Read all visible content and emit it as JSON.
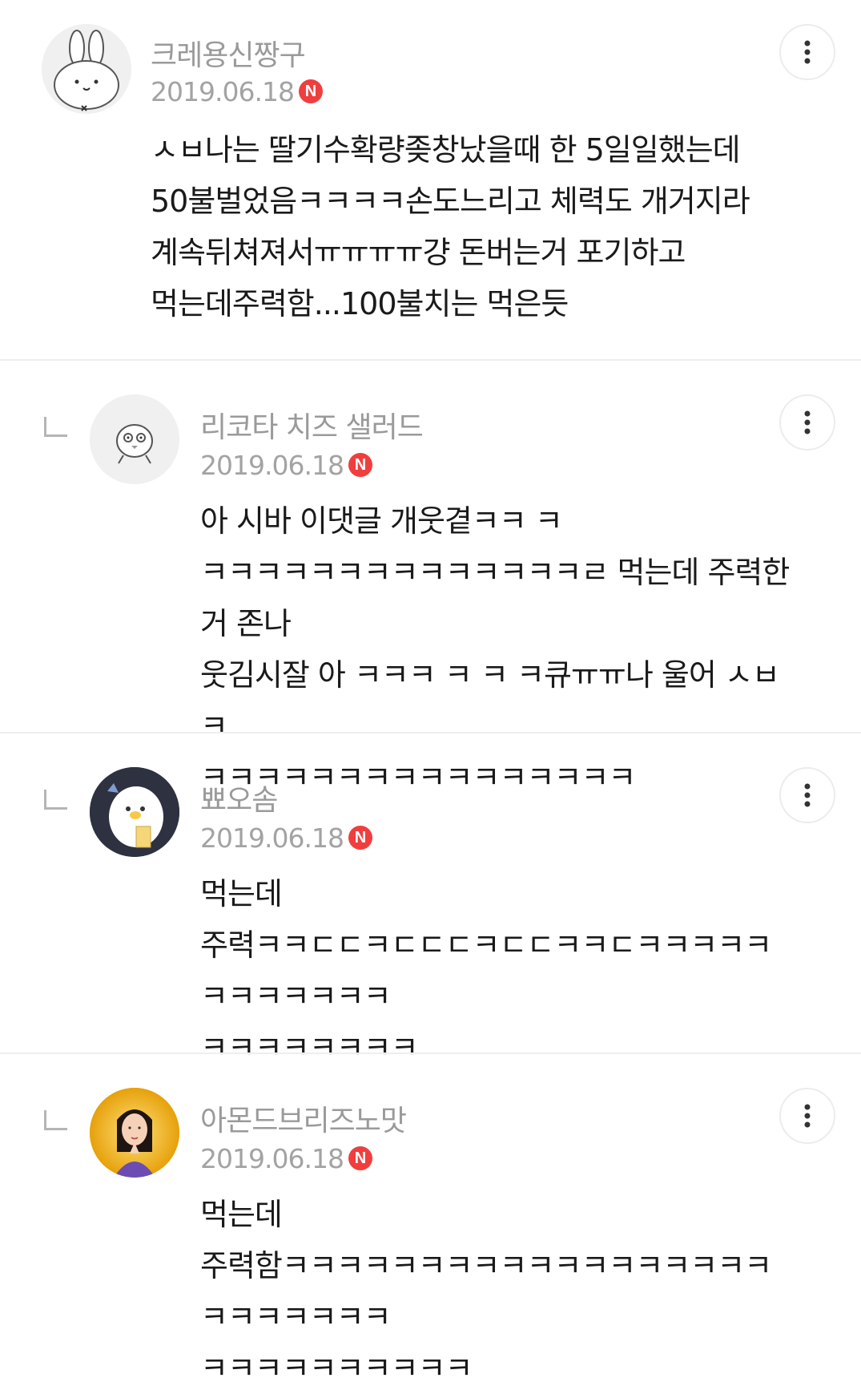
{
  "comments": [
    {
      "nickname": "크레용신짱구",
      "date": "2019.06.18",
      "new_badge": "N",
      "avatar_icon": "bunny-avatar-icon",
      "is_reply": false,
      "text": "ㅅㅂ나는 딸기수확량좆창났을때 한 5일일했는데\n50불벌었음ㅋㅋㅋㅋ손도느리고 체력도 개거지라\n계속뒤쳐져서ㅠㅠㅠㅠ걍 돈버는거 포기하고\n먹는데주력함...100불치는 먹은듯"
    },
    {
      "nickname": "리코타 치즈 샐러드",
      "date": "2019.06.18",
      "new_badge": "N",
      "avatar_icon": "chick-avatar-icon",
      "is_reply": true,
      "text": "아 시바 이댓글 개웃곁ㅋㅋ ㅋ\nㅋㅋㅋㅋㅋㅋㅋㅋㅋㅋㅋㅋㅋㅋㄹ 먹는데 주력한거 존나\n웃김시잘 아 ㅋㅋㅋ ㅋ ㅋ ㅋ큐ㅠㅠ나 울어 ㅅㅂ ㅋ\nㅋㅋㅋㅋㅋㅋㅋㅋㅋㅋㅋㅋㅋㅋㅋㅋ"
    },
    {
      "nickname": "뾰오솜",
      "date": "2019.06.18",
      "new_badge": "N",
      "avatar_icon": "penguin-avatar-icon",
      "is_reply": true,
      "text": "먹는데\n주력ㅋㅋㄷㄷㅋㄷㄷㄷㅋㄷㄷㅋㅋㄷㅋㅋㅋㅋㅋㅋㅋㅋㅋㅋㅋㅋ\nㅋㅋㅋㅋㅋㅋㅋㅋ"
    },
    {
      "nickname": "아몬드브리즈노맛",
      "date": "2019.06.18",
      "new_badge": "N",
      "avatar_icon": "person-avatar-icon",
      "is_reply": true,
      "text": "먹는데\n주력함ㅋㅋㅋㅋㅋㅋㅋㅋㅋㅋㅋㅋㅋㅋㅋㅋㅋㅋㅋㅋㅋㅋㅋㅋㅋ\nㅋㅋㅋㅋㅋㅋㅋㅋㅋㅋ"
    }
  ],
  "colors": {
    "nickname": "#9a9a9a",
    "date": "#a3a3a3",
    "new_badge": "#f03e3e",
    "divider": "#eeeeee",
    "text": "#1a1a1a"
  }
}
